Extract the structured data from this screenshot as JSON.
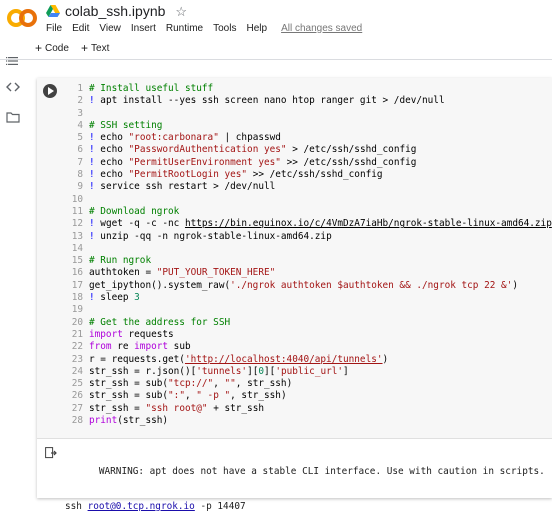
{
  "header": {
    "notebook_title": "colab_ssh.ipynb",
    "menu": [
      "File",
      "Edit",
      "View",
      "Insert",
      "Runtime",
      "Tools",
      "Help"
    ],
    "save_status": "All changes saved"
  },
  "toolbar": {
    "add_code": "Code",
    "add_text": "Text"
  },
  "rail": {
    "icons": [
      "menu-icon",
      "code-snippets-icon",
      "files-icon"
    ]
  },
  "cell": {
    "lines": [
      {
        "n": "1",
        "tokens": [
          {
            "t": "# Install useful stuff",
            "c": "cm"
          }
        ]
      },
      {
        "n": "2",
        "tokens": [
          {
            "t": "! ",
            "c": "bang"
          },
          {
            "t": "apt install --yes ssh screen nano htop ranger git > /dev/null",
            "c": "plain"
          }
        ]
      },
      {
        "n": "3",
        "tokens": []
      },
      {
        "n": "4",
        "tokens": [
          {
            "t": "# SSH setting",
            "c": "cm"
          }
        ]
      },
      {
        "n": "5",
        "tokens": [
          {
            "t": "! ",
            "c": "bang"
          },
          {
            "t": "echo ",
            "c": "plain"
          },
          {
            "t": "\"root:carbonara\"",
            "c": "str"
          },
          {
            "t": " | chpasswd",
            "c": "plain"
          }
        ]
      },
      {
        "n": "6",
        "tokens": [
          {
            "t": "! ",
            "c": "bang"
          },
          {
            "t": "echo ",
            "c": "plain"
          },
          {
            "t": "\"PasswordAuthentication yes\"",
            "c": "str"
          },
          {
            "t": " > /etc/ssh/sshd_config",
            "c": "plain"
          }
        ]
      },
      {
        "n": "7",
        "tokens": [
          {
            "t": "! ",
            "c": "bang"
          },
          {
            "t": "echo ",
            "c": "plain"
          },
          {
            "t": "\"PermitUserEnvironment yes\"",
            "c": "str"
          },
          {
            "t": " >> /etc/ssh/sshd_config",
            "c": "plain"
          }
        ]
      },
      {
        "n": "8",
        "tokens": [
          {
            "t": "! ",
            "c": "bang"
          },
          {
            "t": "echo ",
            "c": "plain"
          },
          {
            "t": "\"PermitRootLogin yes\"",
            "c": "str"
          },
          {
            "t": " >> /etc/ssh/sshd_config",
            "c": "plain"
          }
        ]
      },
      {
        "n": "9",
        "tokens": [
          {
            "t": "! ",
            "c": "bang"
          },
          {
            "t": "service ssh restart > /dev/null",
            "c": "plain"
          }
        ]
      },
      {
        "n": "10",
        "tokens": []
      },
      {
        "n": "11",
        "tokens": [
          {
            "t": "# Download ngrok",
            "c": "cm"
          }
        ]
      },
      {
        "n": "12",
        "tokens": [
          {
            "t": "! ",
            "c": "bang"
          },
          {
            "t": "wget -q -c -nc ",
            "c": "plain"
          },
          {
            "t": "https://bin.equinox.io/c/4VmDzA7iaHb/ngrok-stable-linux-amd64.zip",
            "c": "url"
          }
        ]
      },
      {
        "n": "13",
        "tokens": [
          {
            "t": "! ",
            "c": "bang"
          },
          {
            "t": "unzip -qq -n ngrok-stable-linux-amd64.zip",
            "c": "plain"
          }
        ]
      },
      {
        "n": "14",
        "tokens": []
      },
      {
        "n": "15",
        "tokens": [
          {
            "t": "# Run ngrok",
            "c": "cm"
          }
        ]
      },
      {
        "n": "16",
        "tokens": [
          {
            "t": "authtoken = ",
            "c": "plain"
          },
          {
            "t": "\"PUT_YOUR_TOKEN_HERE\"",
            "c": "str"
          }
        ]
      },
      {
        "n": "17",
        "tokens": [
          {
            "t": "get_ipython().system_raw(",
            "c": "plain"
          },
          {
            "t": "'./ngrok authtoken $authtoken && ./ngrok tcp 22 &'",
            "c": "str"
          },
          {
            "t": ")",
            "c": "plain"
          }
        ]
      },
      {
        "n": "18",
        "tokens": [
          {
            "t": "! ",
            "c": "bang"
          },
          {
            "t": "sleep ",
            "c": "plain"
          },
          {
            "t": "3",
            "c": "num"
          }
        ]
      },
      {
        "n": "19",
        "tokens": []
      },
      {
        "n": "20",
        "tokens": [
          {
            "t": "# Get the address for SSH",
            "c": "cm"
          }
        ]
      },
      {
        "n": "21",
        "tokens": [
          {
            "t": "import",
            "c": "kw"
          },
          {
            "t": " requests",
            "c": "plain"
          }
        ]
      },
      {
        "n": "22",
        "tokens": [
          {
            "t": "from",
            "c": "kw"
          },
          {
            "t": " re ",
            "c": "plain"
          },
          {
            "t": "import",
            "c": "kw"
          },
          {
            "t": " sub",
            "c": "plain"
          }
        ]
      },
      {
        "n": "23",
        "tokens": [
          {
            "t": "r = requests.get(",
            "c": "plain"
          },
          {
            "t": "'http://localhost:4040/api/tunnels'",
            "c": "strurl"
          },
          {
            "t": ")",
            "c": "plain"
          }
        ]
      },
      {
        "n": "24",
        "tokens": [
          {
            "t": "str_ssh = r.json()[",
            "c": "plain"
          },
          {
            "t": "'tunnels'",
            "c": "str"
          },
          {
            "t": "][",
            "c": "plain"
          },
          {
            "t": "0",
            "c": "num"
          },
          {
            "t": "][",
            "c": "plain"
          },
          {
            "t": "'public_url'",
            "c": "str"
          },
          {
            "t": "]",
            "c": "plain"
          }
        ]
      },
      {
        "n": "25",
        "tokens": [
          {
            "t": "str_ssh = sub(",
            "c": "plain"
          },
          {
            "t": "\"tcp://\"",
            "c": "str"
          },
          {
            "t": ", ",
            "c": "plain"
          },
          {
            "t": "\"\"",
            "c": "str"
          },
          {
            "t": ", str_ssh)",
            "c": "plain"
          }
        ]
      },
      {
        "n": "26",
        "tokens": [
          {
            "t": "str_ssh = sub(",
            "c": "plain"
          },
          {
            "t": "\":\"",
            "c": "str"
          },
          {
            "t": ", ",
            "c": "plain"
          },
          {
            "t": "\" -p \"",
            "c": "str"
          },
          {
            "t": ", str_ssh)",
            "c": "plain"
          }
        ]
      },
      {
        "n": "27",
        "tokens": [
          {
            "t": "str_ssh = ",
            "c": "plain"
          },
          {
            "t": "\"ssh root@\"",
            "c": "str"
          },
          {
            "t": " + str_ssh",
            "c": "plain"
          }
        ]
      },
      {
        "n": "28",
        "tokens": [
          {
            "t": "print",
            "c": "kw"
          },
          {
            "t": "(str_ssh)",
            "c": "plain"
          }
        ]
      }
    ],
    "output": {
      "warning": "WARNING: apt does not have a stable CLI interface. Use with caution in scripts.",
      "ssh_prefix": "ssh ",
      "ssh_link": "root@0.tcp.ngrok.io",
      "ssh_suffix": " -p 14407"
    }
  }
}
